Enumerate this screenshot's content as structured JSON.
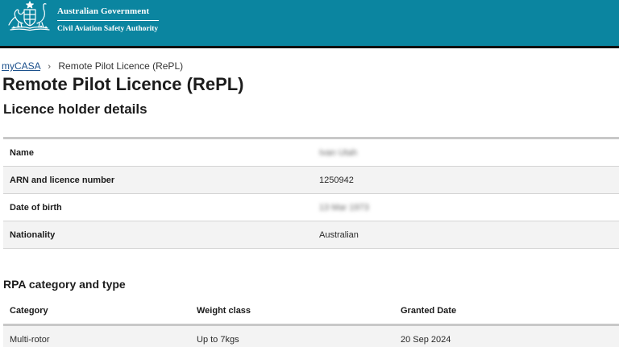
{
  "colors": {
    "header_bg": "#0b85a0",
    "link": "#1a4f8b"
  },
  "header": {
    "logo_icon": "commonwealth-coat-of-arms-icon",
    "gov_name": "Australian Government",
    "agency_name": "Civil Aviation Safety Authority"
  },
  "breadcrumb": {
    "home": "myCASA",
    "separator": "›",
    "current": "Remote Pilot Licence (RePL)"
  },
  "page_title": "Remote Pilot Licence (RePL)",
  "licence_holder": {
    "title": "Licence holder details",
    "rows": [
      {
        "label": "Name",
        "value": "Ivan Utah",
        "blurred": true
      },
      {
        "label": "ARN and licence number",
        "value": "1250942",
        "blurred": false
      },
      {
        "label": "Date of birth",
        "value": "13 Mar 1973",
        "blurred": true
      },
      {
        "label": "Nationality",
        "value": "Australian",
        "blurred": false
      }
    ]
  },
  "rpa": {
    "title": "RPA category and type",
    "headers": [
      "Category",
      "Weight class",
      "Granted Date"
    ],
    "rows": [
      [
        "Multi-rotor",
        "Up to 7kgs",
        "20 Sep 2024"
      ]
    ]
  }
}
